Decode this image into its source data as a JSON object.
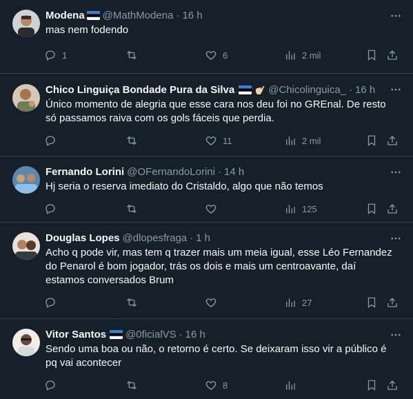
{
  "tweets": [
    {
      "name": "Modena",
      "handle": "@MathModena",
      "separator": "·",
      "time": "16 h",
      "text": "mas nem fodendo",
      "flag": true,
      "extra_icon": "",
      "replies": "1",
      "retweets": "",
      "likes": "6",
      "views": "2 mil"
    },
    {
      "name": "Chico Linguiça Bondade Pura da Silva",
      "handle": "@Chicolinguica_",
      "separator": "·",
      "time": "16 h",
      "text": "Único momento de alegria que esse cara nos deu foi no GREnal. De resto só passamos raiva com os gols fáceis que perdia.",
      "flag": true,
      "extra_icon": "call-me-hand-icon",
      "replies": "",
      "retweets": "",
      "likes": "11",
      "views": "2 mil"
    },
    {
      "name": "Fernando Lorini",
      "handle": "@OFernandoLorini",
      "separator": "·",
      "time": "14 h",
      "text": "Hj seria o reserva imediato do Cristaldo, algo que não temos",
      "flag": false,
      "extra_icon": "",
      "replies": "",
      "retweets": "",
      "likes": "",
      "views": "125"
    },
    {
      "name": "Douglas Lopes",
      "handle": "@dlopesfraga",
      "separator": "·",
      "time": "1 h",
      "text": "Acho q pode vir, mas tem q trazer mais um meia igual, esse Léo Fernandez do Penarol é bom jogador, trás os dois e mais um centroavante, daí estamos conversados Brum",
      "flag": false,
      "extra_icon": "",
      "replies": "",
      "retweets": "",
      "likes": "",
      "views": "27"
    },
    {
      "name": "Vitor Santos",
      "handle": "@0ficialVS",
      "separator": "·",
      "time": "16 h",
      "text": "Sendo uma boa ou não, o retorno é certo. Se deixaram isso vir a público é pq vai acontecer",
      "flag": true,
      "extra_icon": "",
      "replies": "",
      "retweets": "",
      "likes": "8",
      "views": ""
    }
  ],
  "colors": {
    "background": "#15202b",
    "border": "#38444d",
    "muted": "#8b98a5",
    "text": "#f7f9f9",
    "flag_blue": "#3b7dd8"
  }
}
